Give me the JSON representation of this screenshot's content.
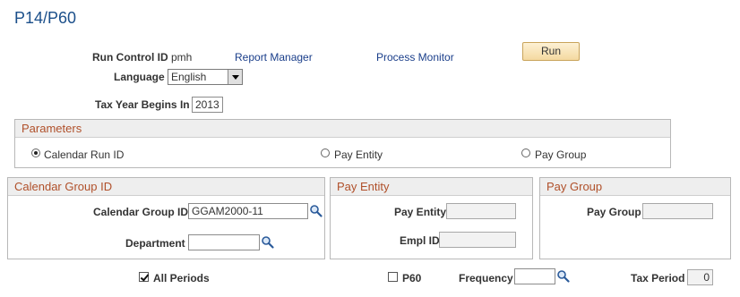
{
  "page_title": "P14/P60",
  "run_control": {
    "label": "Run Control ID",
    "value": "pmh",
    "report_manager": "Report Manager",
    "process_monitor": "Process Monitor",
    "run_button": "Run"
  },
  "language": {
    "label": "Language",
    "value": "English"
  },
  "tax_year": {
    "label": "Tax Year Begins In",
    "value": "2013"
  },
  "parameters": {
    "title": "Parameters",
    "options": [
      "Calendar Run ID",
      "Pay Entity",
      "Pay Group"
    ],
    "selected": "Calendar Run ID"
  },
  "calendar_group": {
    "title": "Calendar Group ID",
    "id_label": "Calendar Group ID",
    "id_value": "GGAM2000-11",
    "department_label": "Department",
    "department_value": ""
  },
  "pay_entity_box": {
    "title": "Pay Entity",
    "pay_entity_label": "Pay Entity",
    "pay_entity_value": "",
    "empl_id_label": "Empl ID",
    "empl_id_value": ""
  },
  "pay_group_box": {
    "title": "Pay Group",
    "pay_group_label": "Pay Group",
    "pay_group_value": ""
  },
  "footer": {
    "all_periods_label": "All Periods",
    "all_periods_checked": true,
    "p60_label": "P60",
    "p60_checked": false,
    "frequency_label": "Frequency",
    "frequency_value": "",
    "tax_period_label": "Tax Period",
    "tax_period_value": "0"
  },
  "colors": {
    "title": "#1b4f8a",
    "section_header": "#b0502a",
    "link": "#1a3e8a",
    "button_bg": "#f4d9a0"
  }
}
